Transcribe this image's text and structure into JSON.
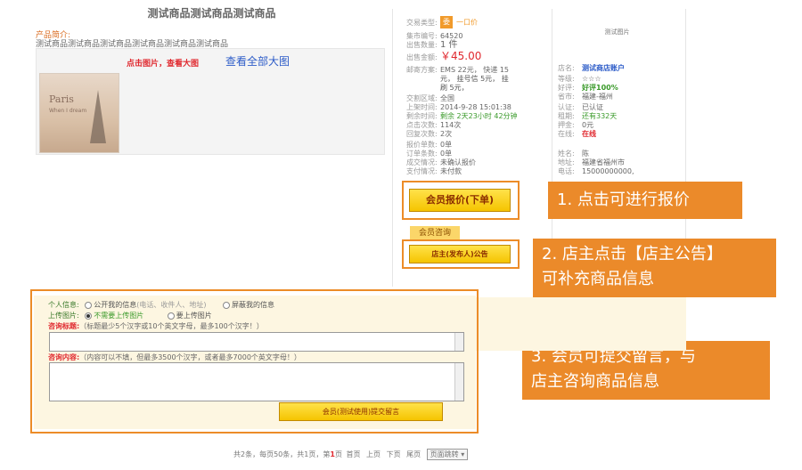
{
  "product": {
    "title": "测试商品测试商品测试商品",
    "intro_label": "产品简介:",
    "intro_text": "测试商品测试商品测试商品测试商品测试商品测试商品",
    "click_enlarge": "点击图片，查看大图",
    "view_all": "查看全部大图",
    "thumb_text": "Paris",
    "thumb_subtext": "When I dream"
  },
  "info": {
    "trade_type_label": "交易类型:",
    "trade_type_badge": "委",
    "trade_type_value": "一口价",
    "market_no_label": "集市编号:",
    "market_no_value": "64520",
    "qty_label": "出售数量:",
    "qty_value": "1 件",
    "amount_label": "出售金额:",
    "amount_value": "￥45.00",
    "shipping_label": "邮寄方案:",
    "shipping_line1": "EMS 22元， 快递 15",
    "shipping_line2": "元， 挂号信 5元， 挂",
    "shipping_line3": "刷 5元，",
    "region_label": "交割区域:",
    "region_value": "全国",
    "listed_label": "上架时间:",
    "listed_value": "2014-9-28 15:01:38",
    "remain_label": "剩余时间:",
    "remain_value": "剩余 2天23小时 42分钟",
    "clicks_label": "点击次数:",
    "clicks_value": "114次",
    "replies_label": "回复次数:",
    "replies_value": "2次",
    "quotes_label": "报价单数:",
    "quotes_value": "0单",
    "orders_label": "订单条数:",
    "orders_value": "0单",
    "deal_label": "成交情况:",
    "deal_value": "未确认报价",
    "pay_label": "支付情况:",
    "pay_value": "未付款"
  },
  "seller": {
    "ad_image": "测试图片",
    "shop_label": "店名:",
    "shop_value": "测试商店账户",
    "level_label": "等级:",
    "level_value": "☆☆☆",
    "rating_label": "好评:",
    "rating_value": "好评100%",
    "province_label": "省市:",
    "province_value": "福建-福州",
    "verify_label": "认证:",
    "verify_value": "已认证",
    "lease_label": "租期:",
    "lease_value": "还有332天",
    "deposit_label": "押金:",
    "deposit_value": "0元",
    "online_label": "在线:",
    "online_value": "在线",
    "name_label": "姓名:",
    "name_value": "陈",
    "addr_label": "地址:",
    "addr_value": "福建省福州市",
    "phone_label": "电话:",
    "phone_value": "15000000000,"
  },
  "actions": {
    "quote_button": "会员报价(下单)",
    "consult_tab": "会员咨询",
    "notice_button": "店主(发布人)公告"
  },
  "callouts": {
    "c1": "1. 点击可进行报价",
    "c2_line1": "2. 店主点击【店主公告】",
    "c2_line2": "可补充商品信息",
    "c3_line1": "3. 会员可提交留言，与",
    "c3_line2": "店主咨询商品信息"
  },
  "form": {
    "personal_label": "个人信息:",
    "opt_public": "公开我的信息",
    "opt_public_hint": "(电话、收件人、地址)",
    "opt_hide": "屏蔽我的信息",
    "upload_label": "上传图片:",
    "opt_no_upload": "不需要上传图片",
    "opt_upload": "要上传图片",
    "subject_label": "咨询标题:",
    "subject_hint": "（标题最少5个汉字或10个英文字母，最多100个汉字！）",
    "content_label": "咨询内容:",
    "content_hint": "（内容可以不填，但最多3500个汉字，或者最多7000个英文字母！）",
    "submit": "会员(测试使用)提交留言"
  },
  "pager": {
    "summary_a": "共2条，每页50条，共1页，第",
    "current": "1",
    "summary_b": "页",
    "first": "首页",
    "prev": "上页",
    "next": "下页",
    "last": "尾页",
    "jump": "页面跳转"
  },
  "colors": {
    "accent_orange": "#eb8a2a",
    "price_red": "#e0292f",
    "link_blue": "#2d5cc8",
    "ok_green": "#3a9a2a"
  }
}
